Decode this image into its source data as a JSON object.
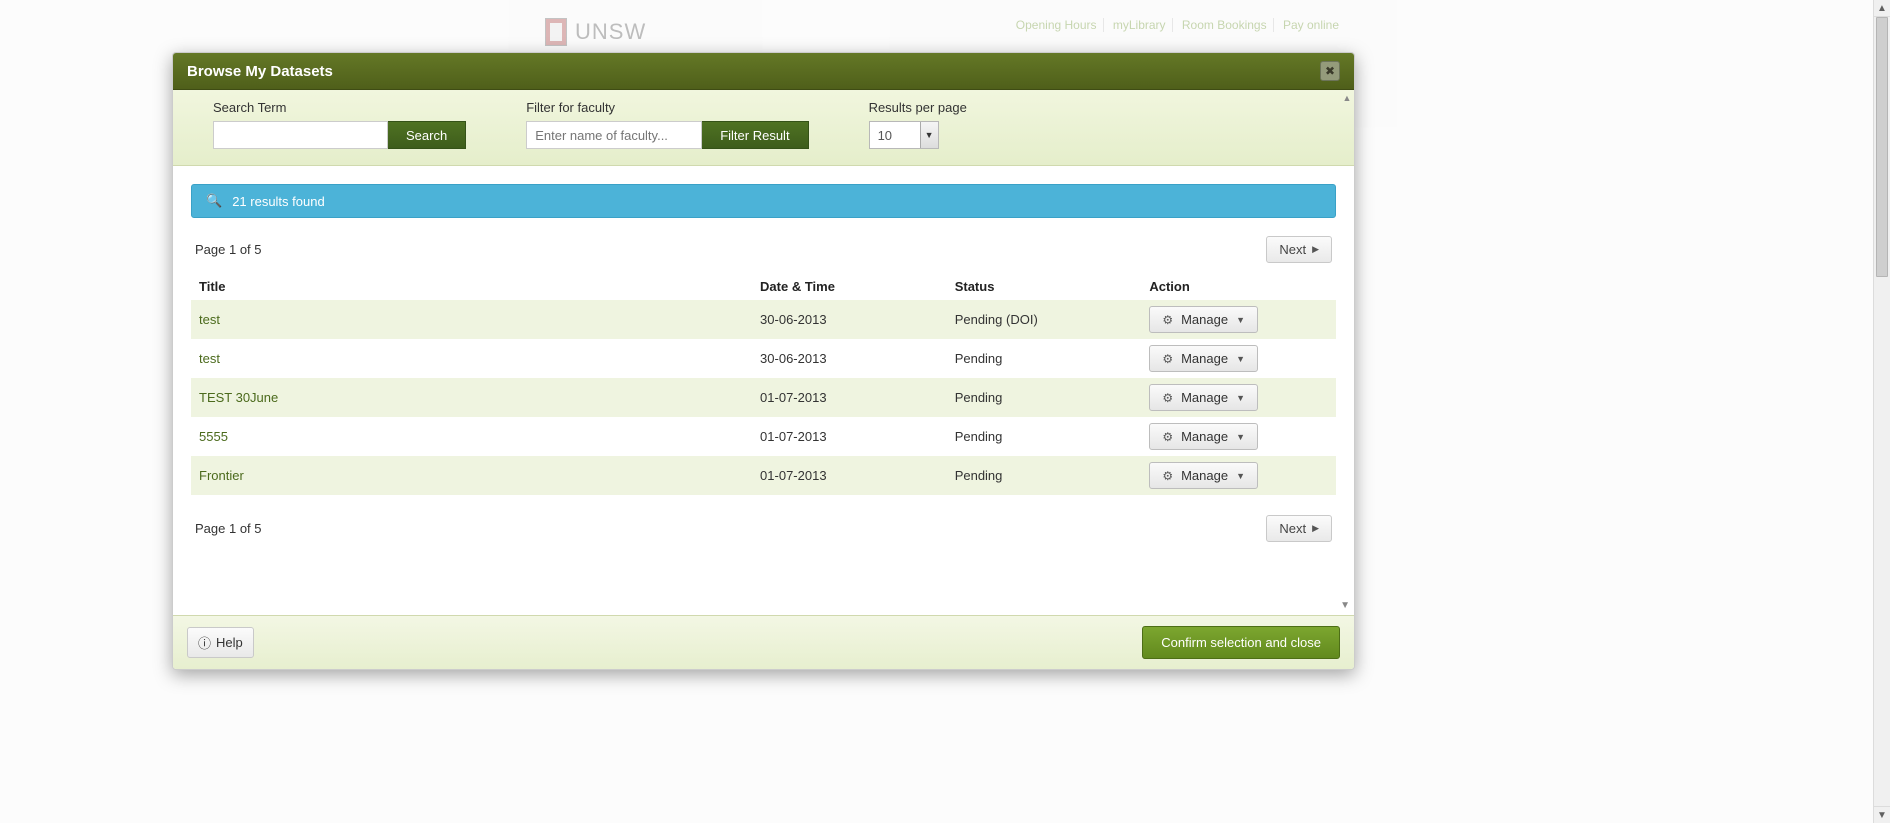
{
  "background": {
    "brand": "UNSW",
    "links": [
      "Opening Hours",
      "myLibrary",
      "Room Bookings",
      "Pay online"
    ]
  },
  "modal": {
    "title": "Browse My Datasets",
    "filters": {
      "search_label": "Search Term",
      "search_button": "Search",
      "faculty_label": "Filter for faculty",
      "faculty_placeholder": "Enter name of faculty...",
      "faculty_button": "Filter Result",
      "rpp_label": "Results per page",
      "rpp_value": "10"
    },
    "results_banner": "21 results found",
    "page_info": "Page 1 of 5",
    "next_label": "Next",
    "columns": {
      "title": "Title",
      "date": "Date & Time",
      "status": "Status",
      "action": "Action"
    },
    "manage_label": "Manage",
    "rows": [
      {
        "title": "test",
        "date": "30-06-2013",
        "status": "Pending (DOI)"
      },
      {
        "title": "test",
        "date": "30-06-2013",
        "status": "Pending"
      },
      {
        "title": "TEST 30June",
        "date": "01-07-2013",
        "status": "Pending"
      },
      {
        "title": "5555",
        "date": "01-07-2013",
        "status": "Pending"
      },
      {
        "title": "Frontier",
        "date": "01-07-2013",
        "status": "Pending"
      }
    ],
    "footer": {
      "help_label": "Help",
      "confirm_label": "Confirm selection and close"
    }
  }
}
